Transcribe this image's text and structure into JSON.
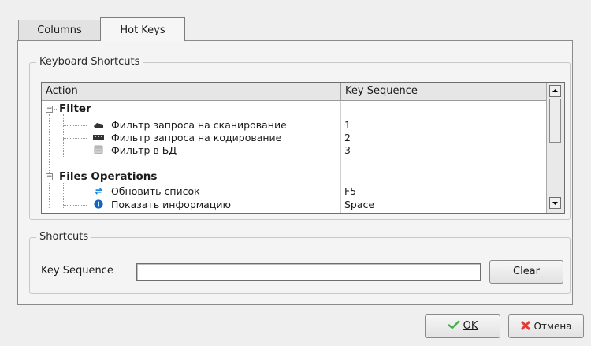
{
  "tabs": [
    {
      "label": "Columns",
      "active": false
    },
    {
      "label": "Hot Keys",
      "active": true
    }
  ],
  "keyboard_shortcuts": {
    "title": "Keyboard Shortcuts",
    "columns": [
      "Action",
      "Key Sequence"
    ],
    "groups": [
      {
        "label": "Filter",
        "expanded": true,
        "items": [
          {
            "action": "Фильтр запроса на сканирование",
            "key": "1",
            "icon": "scanner-icon"
          },
          {
            "action": "Фильтр запроса на кодирование",
            "key": "2",
            "icon": "keyboard-icon"
          },
          {
            "action": "Фильтр в БД",
            "key": "3",
            "icon": "database-icon"
          }
        ]
      },
      {
        "label": "Files Operations",
        "expanded": true,
        "items": [
          {
            "action": "Обновить список",
            "key": "F5",
            "icon": "refresh-icon"
          },
          {
            "action": "Показать информацию",
            "key": "Space",
            "icon": "info-icon"
          }
        ]
      }
    ]
  },
  "shortcuts": {
    "title": "Shortcuts",
    "key_sequence_label": "Key Sequence",
    "key_sequence_value": "",
    "clear_label": "Clear"
  },
  "footer": {
    "ok_label": "OK",
    "cancel_label": "Отмена"
  },
  "colors": {
    "ok_check": "#4caf50",
    "cancel_x": "#e53935",
    "refresh": "#1e88e5",
    "info": "#1565c0"
  }
}
